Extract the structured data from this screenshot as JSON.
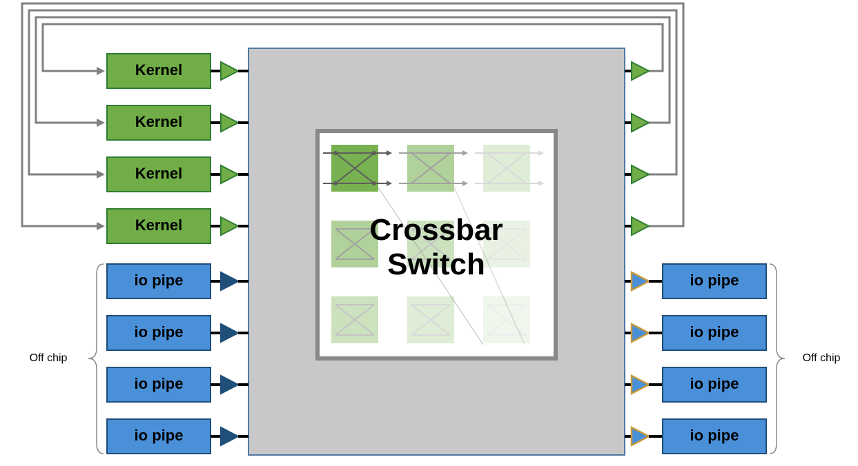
{
  "kernel_labels": [
    "Kernel",
    "Kernel",
    "Kernel",
    "Kernel"
  ],
  "io_left_labels": [
    "io pipe",
    "io pipe",
    "io pipe",
    "io pipe"
  ],
  "io_right_labels": [
    "io pipe",
    "io pipe",
    "io pipe",
    "io pipe"
  ],
  "off_chip_left": "Off chip",
  "off_chip_right": "Off chip",
  "crossbar_title_line1": "Crossbar",
  "crossbar_title_line2": "Switch",
  "colors": {
    "kernel": "#70ad47",
    "io": "#4a90d9",
    "chip": "#c8c8c8"
  }
}
